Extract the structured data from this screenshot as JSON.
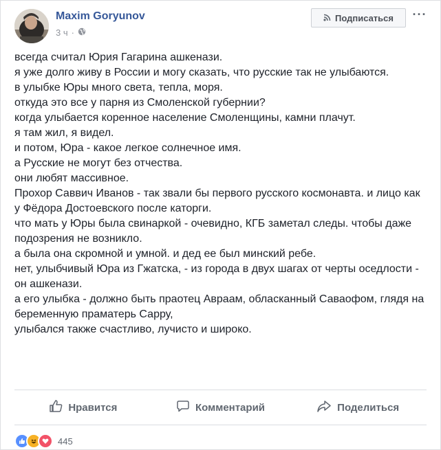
{
  "author": {
    "name": "Maxim Goryunov"
  },
  "meta": {
    "time": "3 ч",
    "separator": "·",
    "privacy_icon": "globe-icon"
  },
  "header": {
    "follow_label": "Подписаться",
    "follow_icon": "rss-icon",
    "more_label": "···"
  },
  "post": {
    "lines": [
      "всегда считал Юрия Гагарина ашкенази.",
      "я уже долго живу в России и могу сказать, что русские так не улыбаются.",
      "в улыбке Юры много света, тепла, моря.",
      "откуда это все у парня из Смоленской губернии?",
      "когда улыбается коренное население Смоленщины, камни плачут.",
      "я там жил, я видел.",
      "и потом, Юра - какое легкое солнечное имя.",
      "а Русские не могут без отчества.",
      "они любят массивное.",
      "Прохор Саввич Иванов - так звали бы первого русского космонавта. и лицо как у Фёдора Достоевского после каторги.",
      "что мать у Юры была свинаркой - очевидно, КГБ заметал следы. чтобы даже подозрения не возникло.",
      "а была она скромной и умной. и дед ее был минский ребе.",
      "нет, улыбчивый Юра из Гжатска, - из города в двух шагах от черты оседлости - он ашкенази.",
      "а его улыбка - должно быть праотец Авраам, обласканный Саваофом, глядя на беременную праматерь Сарру,",
      "улыбался также счастливо, лучисто и широко."
    ]
  },
  "actions": {
    "like": "Нравится",
    "comment": "Комментарий",
    "share": "Поделиться"
  },
  "reactions": {
    "count": "445",
    "types": [
      "like",
      "haha",
      "love"
    ],
    "colors": {
      "like": "#5890ff",
      "haha": "#f7b125",
      "love": "#f25268"
    }
  }
}
